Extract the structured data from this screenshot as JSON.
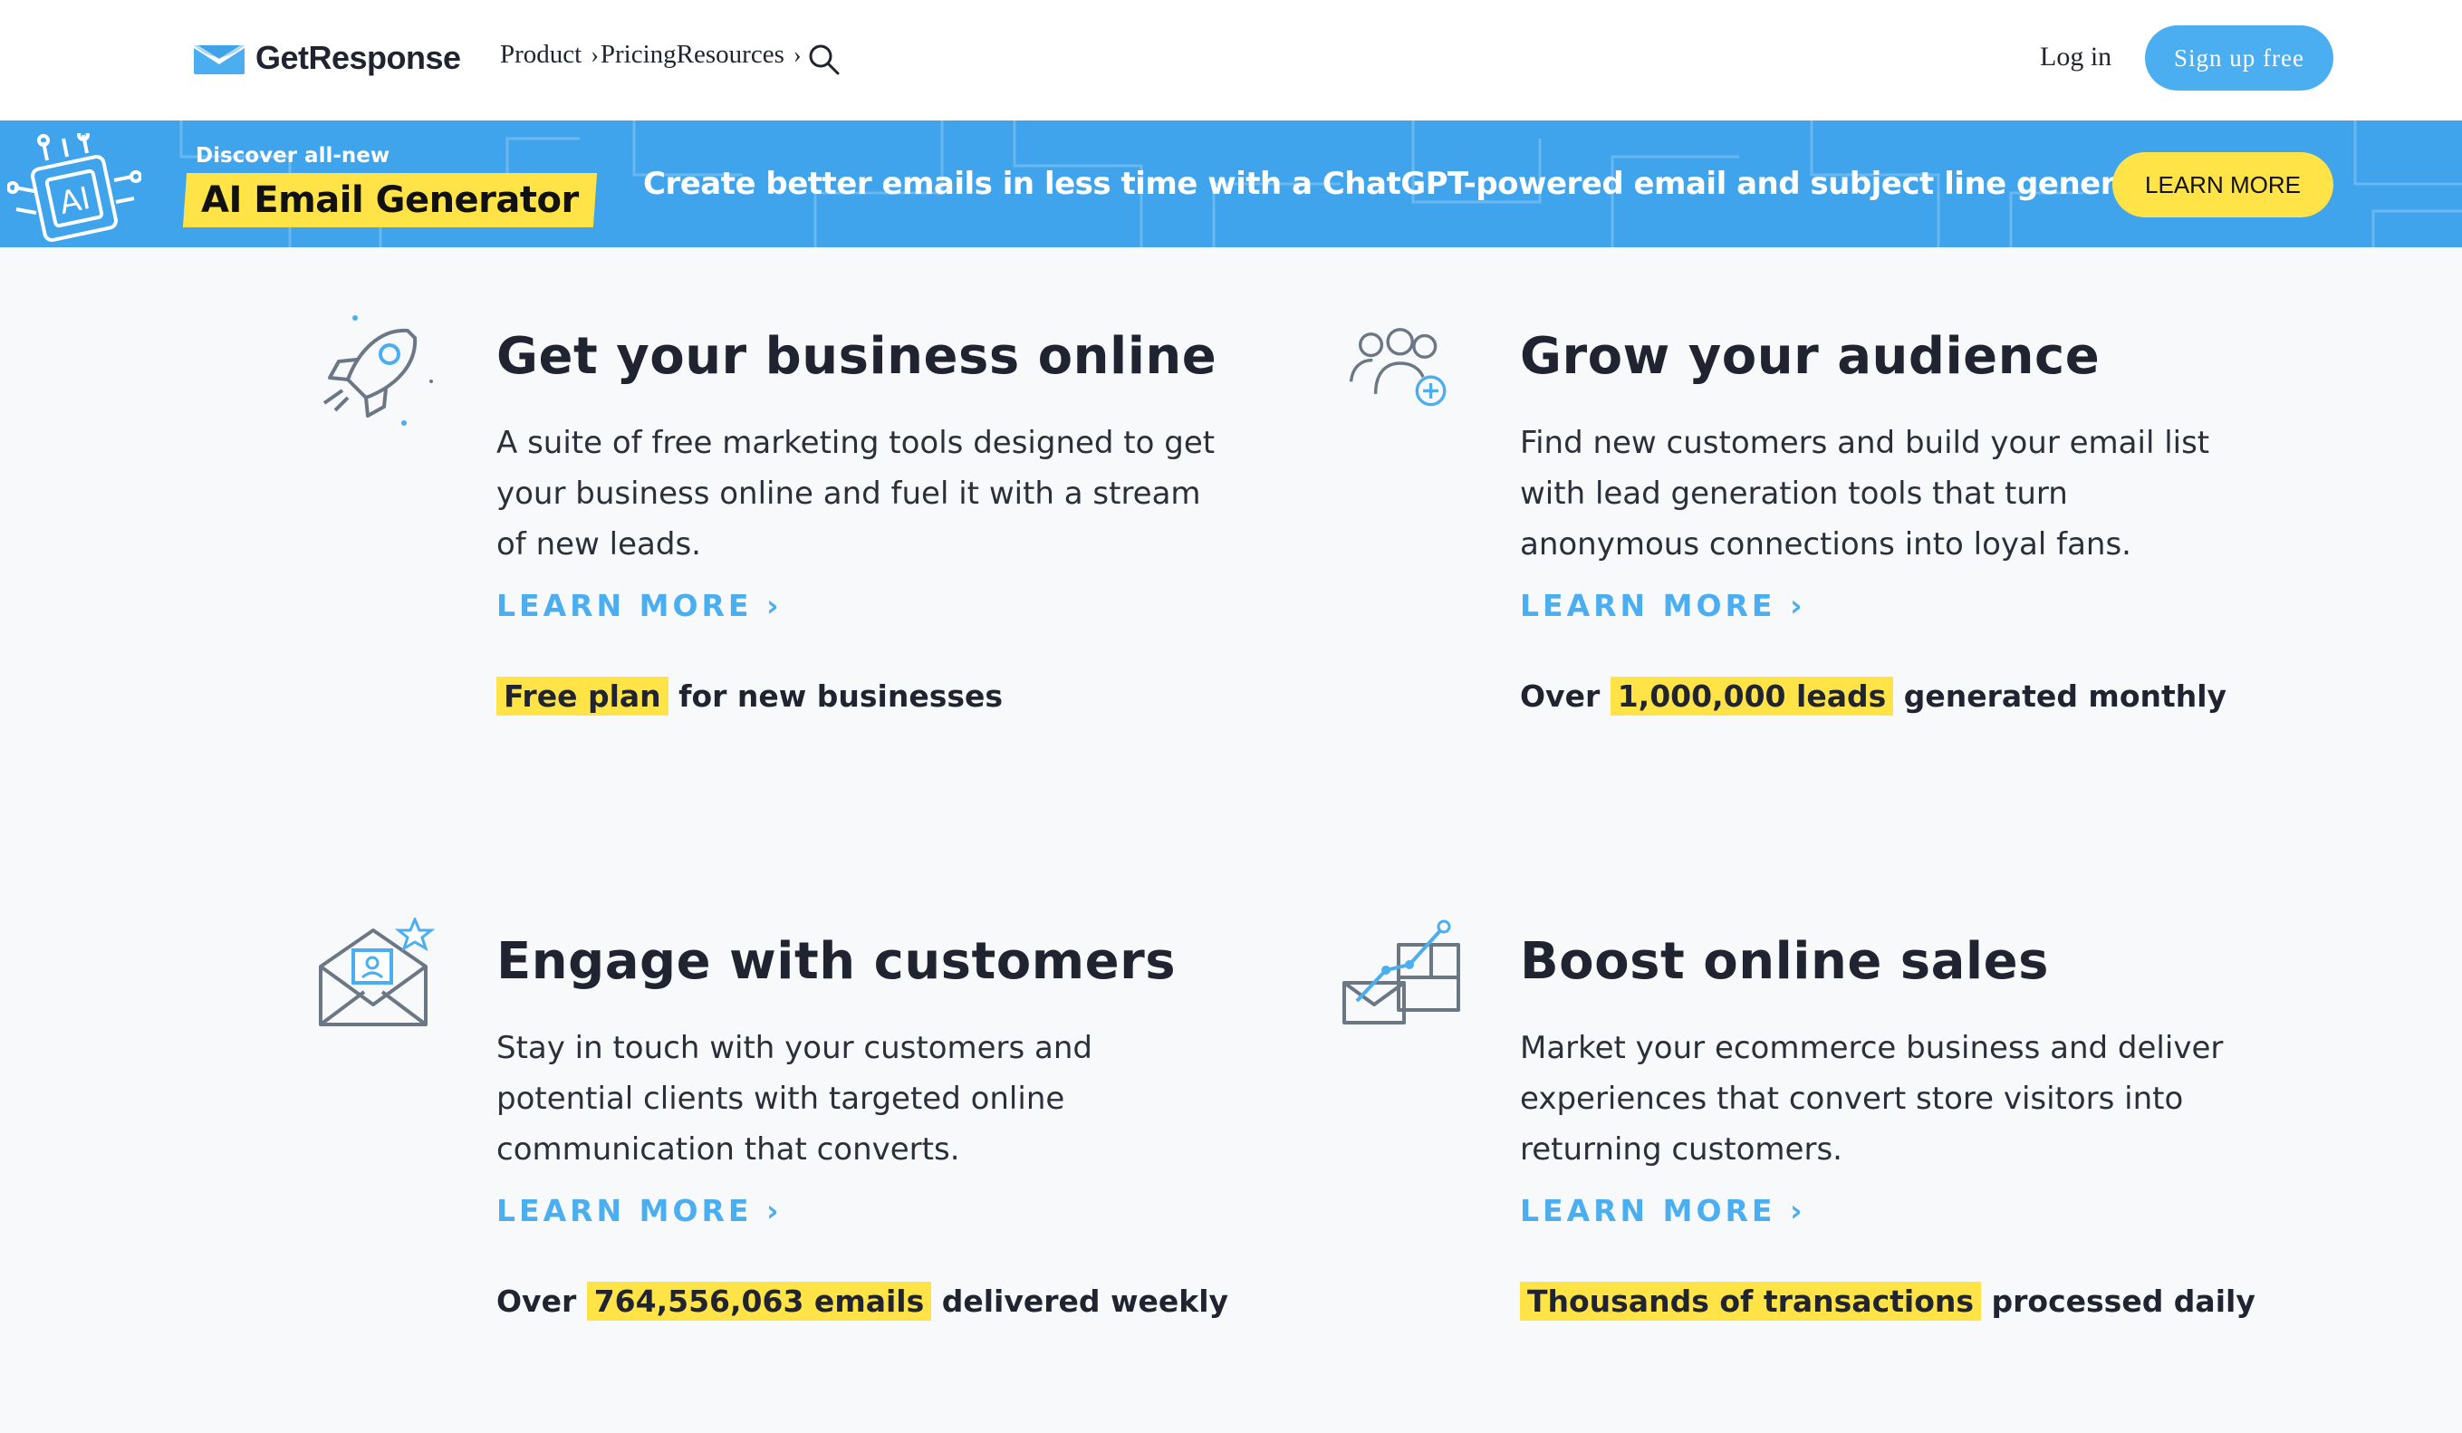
{
  "nav": {
    "logo_text": "GetResponse",
    "product": "Product",
    "pricing": "Pricing",
    "resources": "Resources",
    "login": "Log in",
    "signup": "Sign up free"
  },
  "banner": {
    "chip_label": "AI",
    "discover": "Discover all-new",
    "title": "AI Email Generator",
    "message": "Create better emails in less time with a ChatGPT-powered email and subject line generator.",
    "button": "LEARN MORE"
  },
  "features": [
    {
      "icon": "rocket-icon",
      "title": "Get your business online",
      "description": "A suite of free marketing tools designed to get your business online and fuel it with a stream of new leads.",
      "learn_more": "LEARN MORE ›",
      "stat_pre": "",
      "stat_highlight": "Free plan",
      "stat_post": " for new businesses"
    },
    {
      "icon": "audience-add-icon",
      "title": "Grow your audience",
      "description": "Find new customers and build your email list with lead generation tools that turn anonymous connections into loyal fans.",
      "learn_more": "LEARN MORE ›",
      "stat_pre": "Over ",
      "stat_highlight": "1,000,000 leads",
      "stat_post": " generated monthly"
    },
    {
      "icon": "envelope-star-icon",
      "title": "Engage with customers",
      "description": "Stay in touch with your customers and potential clients with targeted online communication that converts.",
      "learn_more": "LEARN MORE ›",
      "stat_pre": "Over ",
      "stat_highlight": "764,556,063 emails",
      "stat_post": " delivered weekly"
    },
    {
      "icon": "sales-growth-icon",
      "title": "Boost online sales",
      "description": "Market your ecommerce business and deliver experiences that convert store visitors into returning customers.",
      "learn_more": "LEARN MORE ›",
      "stat_pre": "",
      "stat_highlight": "Thousands of transactions",
      "stat_post": " processed daily"
    }
  ],
  "colors": {
    "brand_blue": "#4aaef0",
    "banner_blue": "#3fa4ec",
    "highlight_yellow": "#ffe347",
    "text_dark": "#1f2430"
  }
}
